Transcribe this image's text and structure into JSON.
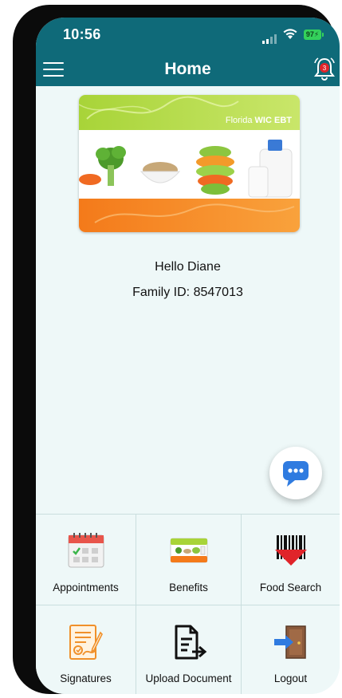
{
  "status": {
    "time": "10:56",
    "battery": "97"
  },
  "header": {
    "title": "Home",
    "notification_count": "3"
  },
  "card": {
    "brand_prefix": "Florida ",
    "brand_name": "WIC EBT"
  },
  "greeting": "Hello Diane",
  "family_id": "Family ID: 8547013",
  "tiles": [
    {
      "label": "Appointments",
      "icon": "calendar-icon"
    },
    {
      "label": "Benefits",
      "icon": "wic-card-icon"
    },
    {
      "label": "Food Search",
      "icon": "barcode-scan-icon"
    },
    {
      "label": "Signatures",
      "icon": "signature-document-icon"
    },
    {
      "label": "Upload Document",
      "icon": "document-upload-icon"
    },
    {
      "label": "Logout",
      "icon": "logout-door-icon"
    }
  ],
  "colors": {
    "header": "#0f6a79",
    "background": "#eef8f8",
    "card_green": "#a8d438",
    "card_orange": "#f47a1a",
    "chat_blue": "#2f7be0"
  }
}
